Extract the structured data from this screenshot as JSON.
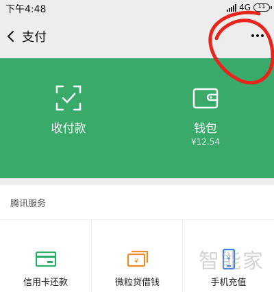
{
  "status_bar": {
    "time": "下午4:48",
    "network": "4G",
    "battery": "11"
  },
  "nav": {
    "title": "支付",
    "back_icon": "back-chevron-icon",
    "more_icon": "more-dots-icon"
  },
  "panel": {
    "background": "#3aaa6a",
    "items": [
      {
        "label": "收付款",
        "icon": "scan-icon"
      },
      {
        "label": "钱包",
        "sub": "¥12.54",
        "icon": "wallet-icon"
      }
    ]
  },
  "section": {
    "title": "腾讯服务"
  },
  "services": [
    {
      "label": "信用卡还款",
      "icon": "credit-card-icon",
      "color": "#2aae67"
    },
    {
      "label": "微粒贷借钱",
      "icon": "loan-icon",
      "color": "#f08a24"
    },
    {
      "label": "手机充值",
      "icon": "phone-recharge-icon",
      "color": "#3b7de0"
    }
  ],
  "watermark": "智能家",
  "annotation_color": "#e8241c"
}
